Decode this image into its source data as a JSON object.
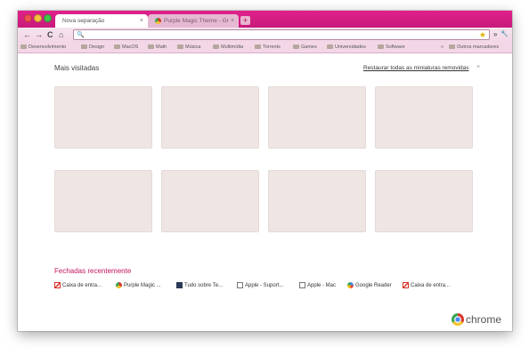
{
  "tabs": [
    {
      "title": "Nova separação",
      "close": "×"
    },
    {
      "title": "Purple Magic Theme - Gr",
      "close": "×"
    }
  ],
  "new_tab_label": "+",
  "toolbar": {
    "back": "←",
    "forward": "→",
    "reload": "C",
    "home": "⌂",
    "omnibox_value": "",
    "search_glyph": "🔍",
    "star": "★",
    "extensions": "»",
    "wrench": "🔧"
  },
  "bookmarks": [
    "Desenvolvimento",
    "Design",
    "MacOS",
    "Math",
    "Música",
    "Multimídia",
    "Torrents",
    "Games",
    "Universidades",
    "Software"
  ],
  "bookmarks_overflow": "»",
  "other_bookmarks": "Outros marcadores",
  "most_visited": {
    "title": "Mais visitadas",
    "restore_label": "Restaurar todas as miniaturas removidas",
    "restore_close": "×"
  },
  "recently_closed": {
    "title": "Fechadas recentemente",
    "items": [
      {
        "label": "Caixa de entra...",
        "icon": "gmail-icon"
      },
      {
        "label": "Purple Magic ...",
        "icon": "chrome-icon"
      },
      {
        "label": "Tudo sobre Te...",
        "icon": "tudo-icon"
      },
      {
        "label": "Apple - Suport...",
        "icon": "page-icon"
      },
      {
        "label": "Apple - Mac",
        "icon": "page-icon"
      },
      {
        "label": "Google Reader",
        "icon": "google-icon"
      },
      {
        "label": "Caixa de entra...",
        "icon": "gmail-icon"
      }
    ]
  },
  "brand": "chrome",
  "colors": {
    "theme_accent": "#d31a82",
    "recent_title": "#c0145f"
  }
}
